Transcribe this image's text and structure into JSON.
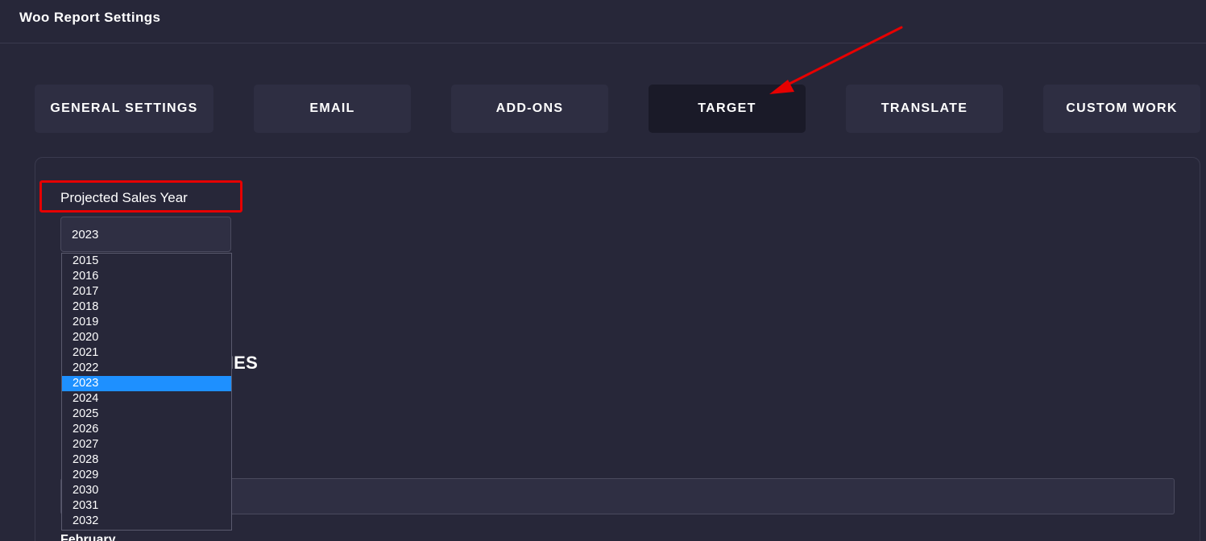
{
  "header": {
    "title": "Woo Report Settings"
  },
  "tabs": [
    {
      "label": "GENERAL SETTINGS",
      "active": false
    },
    {
      "label": "EMAIL",
      "active": false
    },
    {
      "label": "ADD-ONS",
      "active": false
    },
    {
      "label": "TARGET",
      "active": true
    },
    {
      "label": "TRANSLATE",
      "active": false
    },
    {
      "label": "CUSTOM WORK",
      "active": false
    }
  ],
  "form": {
    "year_label": "Projected Sales Year",
    "year_value": "2023",
    "section_heading_visible": "NTHES",
    "next_label_partial": "February"
  },
  "dropdown": {
    "options": [
      "2015",
      "2016",
      "2017",
      "2018",
      "2019",
      "2020",
      "2021",
      "2022",
      "2023",
      "2024",
      "2025",
      "2026",
      "2027",
      "2028",
      "2029",
      "2030",
      "2031",
      "2032"
    ],
    "selected": "2023"
  },
  "colors": {
    "background": "#272739",
    "tab": "#2e2e42",
    "tab_active": "#1a1a28",
    "option_selected": "#1e90ff",
    "annotation": "#e60000"
  }
}
